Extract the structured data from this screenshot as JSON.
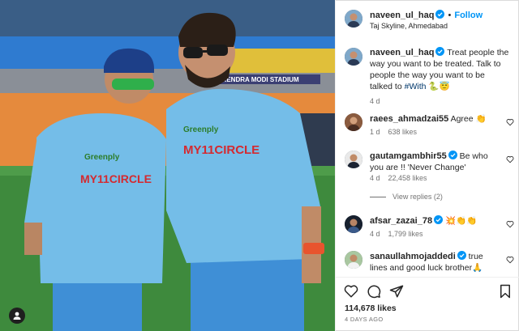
{
  "post": {
    "username": "naveen_ul_haq",
    "follow_label": "Follow",
    "location": "Taj Skyline, Ahmedabad",
    "caption_user": "naveen_ul_haq",
    "caption_text": "Treat people the way you want to be treated. Talk to people the way you want to be talked to",
    "caption_hashtag": "#With",
    "caption_emoji": "🐍😇",
    "caption_age": "4 d"
  },
  "photo": {
    "stadium_banner": "NARENDRA MODI STADIUM",
    "jersey_sponsor_left": "Greenply",
    "jersey_main_left": "MY11CIRCLE",
    "jersey_sponsor_right": "Greenply",
    "jersey_main_right": "MY11CIRCLE"
  },
  "comments": [
    {
      "user": "raees_ahmadzai55",
      "verified": false,
      "text": "Agree 👏",
      "age": "1 d",
      "likes": "638 likes"
    },
    {
      "user": "gautamgambhir55",
      "verified": true,
      "text": "Be who you are !! 'Never Change'",
      "age": "4 d",
      "likes": "22,458 likes",
      "replies": "View replies (2)"
    },
    {
      "user": "afsar_zazai_78",
      "verified": true,
      "text": "💥👏👏",
      "age": "4 d",
      "likes": "1,799 likes"
    },
    {
      "user": "sanaullahmojaddedi",
      "verified": true,
      "text": "true lines and good luck brother🙏",
      "age": "",
      "likes": ""
    }
  ],
  "footer": {
    "likes": "114,678 likes",
    "time_ago": "4 DAYS AGO"
  },
  "icons": {
    "verified": "verified-badge-icon",
    "like": "heart-icon",
    "comment": "comment-icon",
    "share": "send-icon",
    "save": "bookmark-icon",
    "tag": "user-tag-icon"
  },
  "colors": {
    "link": "#0095f6",
    "verified": "#0095f6",
    "muted": "#737373",
    "text": "#262626"
  }
}
